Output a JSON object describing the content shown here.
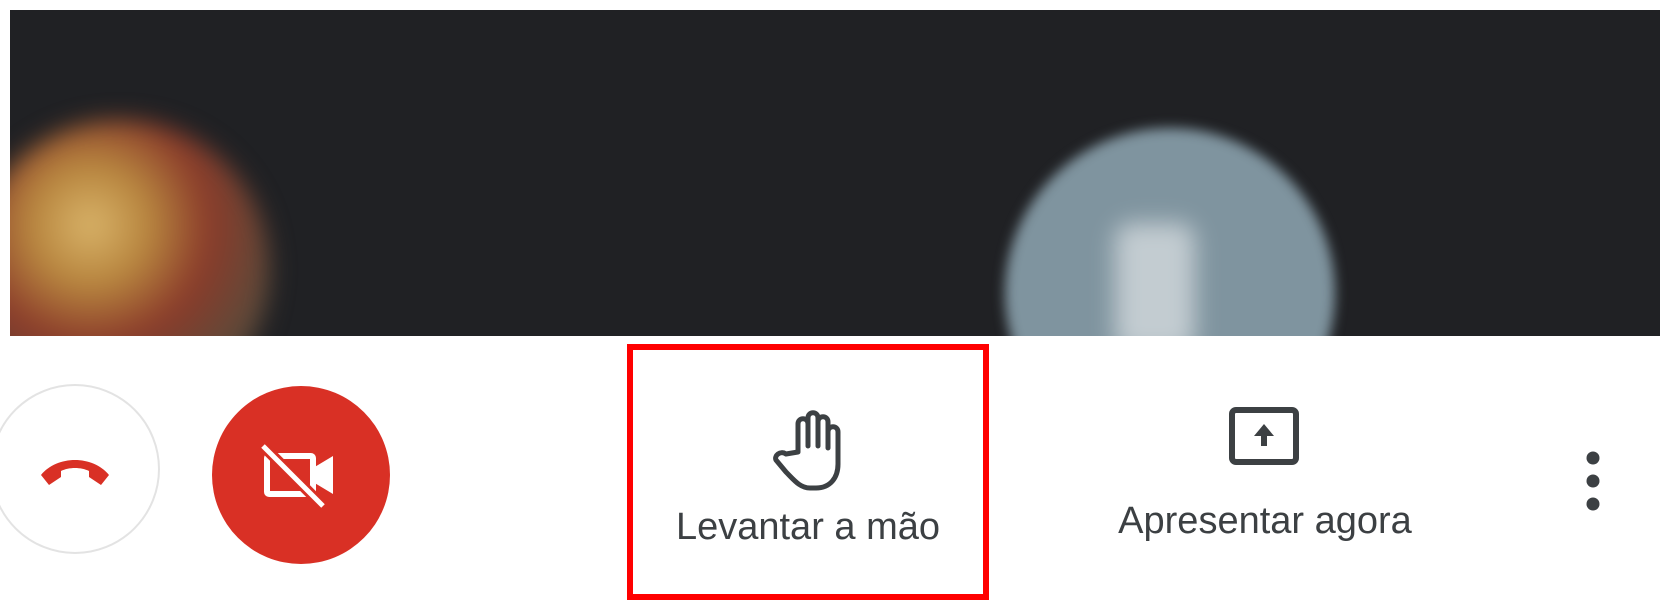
{
  "meeting": {
    "controls": {
      "hangup": {
        "icon": "phone-hangup-icon",
        "color": "#d93025"
      },
      "camera": {
        "icon": "camera-off-icon",
        "background": "#d93025"
      },
      "raise_hand": {
        "label": "Levantar a mão",
        "icon": "hand-icon",
        "highlight_color": "#ff0000"
      },
      "present": {
        "label": "Apresentar agora",
        "icon": "present-screen-icon"
      },
      "more": {
        "icon": "more-vertical-icon"
      }
    }
  }
}
